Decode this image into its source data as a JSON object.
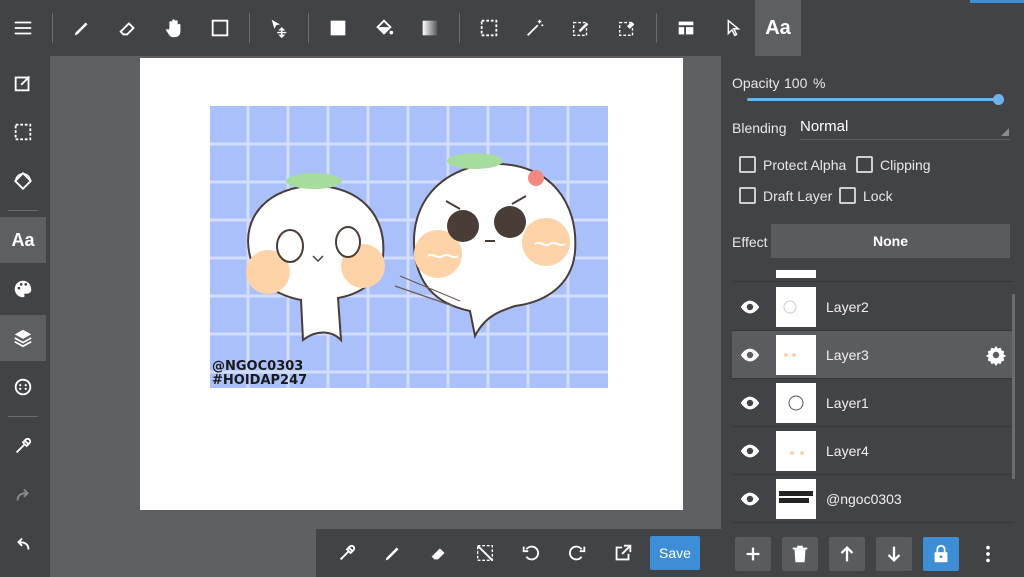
{
  "top_toolbar": {
    "items": [
      "brush-icon",
      "eraser-icon",
      "hand-icon",
      "rectangle-icon",
      "move-icon",
      "fill-rect-icon",
      "bucket-icon",
      "gradient-icon",
      "select-rect-icon",
      "magic-wand-icon",
      "select-pen-icon",
      "select-eraser-icon",
      "frame-icon",
      "cursor-icon"
    ],
    "text_tool_label": "Aa"
  },
  "left_toolbar": {
    "text_label": "Aa"
  },
  "artwork": {
    "watermark_line1": "@NGOC0303",
    "watermark_line2": "#HOIDAP247",
    "colors": {
      "grid_bg": "#a9c0fb",
      "grid_line": "#cfdcff",
      "blush": "#ffd3a8",
      "sprout": "#a7dc9f"
    }
  },
  "bottom_toolbar": {
    "save_label": "Save"
  },
  "right_panel": {
    "opacity_label": "Opacity",
    "opacity_value": "100",
    "opacity_unit": "%",
    "opacity_level": 1.0,
    "blending_label": "Blending",
    "blending_value": "Normal",
    "protect_alpha_label": "Protect Alpha",
    "clipping_label": "Clipping",
    "draft_layer_label": "Draft Layer",
    "lock_label": "Lock",
    "effect_label": "Effect",
    "effect_value": "None"
  },
  "layers": [
    {
      "name": "Layer2",
      "selected": false
    },
    {
      "name": "Layer3",
      "selected": true
    },
    {
      "name": "Layer1",
      "selected": false
    },
    {
      "name": "Layer4",
      "selected": false
    },
    {
      "name": "@ngoc0303",
      "selected": false
    }
  ],
  "accent_color": "#3d8ed6"
}
